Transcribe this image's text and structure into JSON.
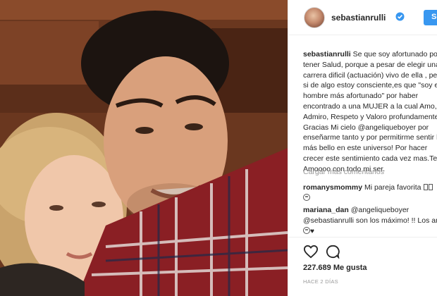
{
  "header": {
    "username": "sebastianrulli",
    "follow_label": "Seguir"
  },
  "caption": {
    "username": "sebastianrulli",
    "lines": [
      "Se que soy afortunado por",
      "tener Salud, porque a pesar de elegir una",
      "carrera dificil (actuación) vivo de ella , pero",
      "si de algo estoy consciente,es que \"soy el",
      "hombre más afortunado\" por haber",
      "encontrado a una MUJER a la cual Amo,",
      "Admiro, Respeto y Valoro profundamente.",
      "Gracias Mi cielo @angeliqueboyer por",
      "enseñarme tanto y por permitirme sentir lo",
      "más bello en este universo! Por hacer",
      "crecer este sentimiento cada vez mas.Te",
      "Amoooo con todo mi ser."
    ]
  },
  "load_more": "Cargar más comentarios",
  "comments": [
    {
      "username": "romanysmommy",
      "text": "Mi pareja favorita"
    },
    {
      "username": "mariana_dan",
      "text": "@angeliqueboyer",
      "line2": "@sebastianrulli son los máximo! !! Los amo"
    }
  ],
  "likes": "227.689 Me gusta",
  "date": "HACE 2 DÍAS",
  "icons": {
    "verified": "verified-badge-icon",
    "like": "heart-outline-icon",
    "comment": "comment-bubble-icon"
  },
  "colors": {
    "accent": "#3897f0",
    "muted": "#999999",
    "text": "#262626"
  }
}
